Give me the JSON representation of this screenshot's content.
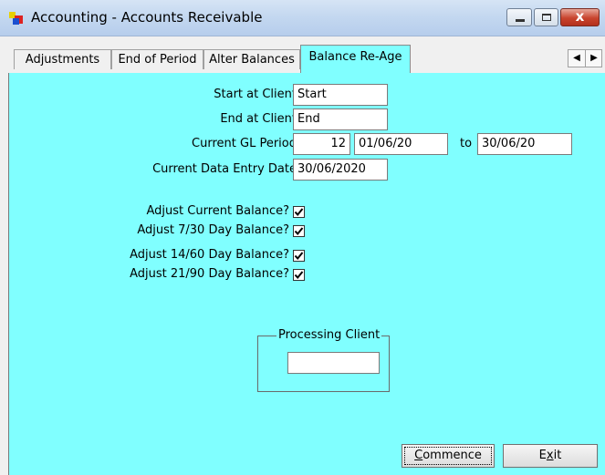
{
  "window": {
    "title": "Accounting - Accounts Receivable",
    "close_glyph": "x"
  },
  "tabs": [
    {
      "label": "Adjustments"
    },
    {
      "label": "End of Period"
    },
    {
      "label": "Alter Balances"
    },
    {
      "label": "Balance Re-Age",
      "active": true
    }
  ],
  "form": {
    "start_client_label": "Start at Client",
    "start_client_value": "Start",
    "end_client_label": "End at Client",
    "end_client_value": "End",
    "gl_period_label": "Current GL Period",
    "gl_period_value": "12",
    "gl_period_from": "01/06/20",
    "to_label": "to",
    "gl_period_to": "30/06/20",
    "data_entry_label": "Current Data Entry Date",
    "data_entry_value": "30/06/2020",
    "checkboxes": [
      {
        "label": "Adjust Current Balance?",
        "checked": true
      },
      {
        "label": "Adjust 7/30 Day Balance?",
        "checked": true
      },
      {
        "label": "Adjust 14/60 Day Balance?",
        "checked": true
      },
      {
        "label": "Adjust 21/90 Day Balance?",
        "checked": true
      }
    ]
  },
  "processing": {
    "title": "Processing Client",
    "value": ""
  },
  "buttons": {
    "commence_pre": "",
    "commence_ul": "C",
    "commence_post": "ommence",
    "exit_pre": "E",
    "exit_ul": "x",
    "exit_post": "it"
  },
  "colors": {
    "panel_bg": "#80ffff",
    "titlebar": "#c4d8f0",
    "close_button": "#c8432d"
  }
}
